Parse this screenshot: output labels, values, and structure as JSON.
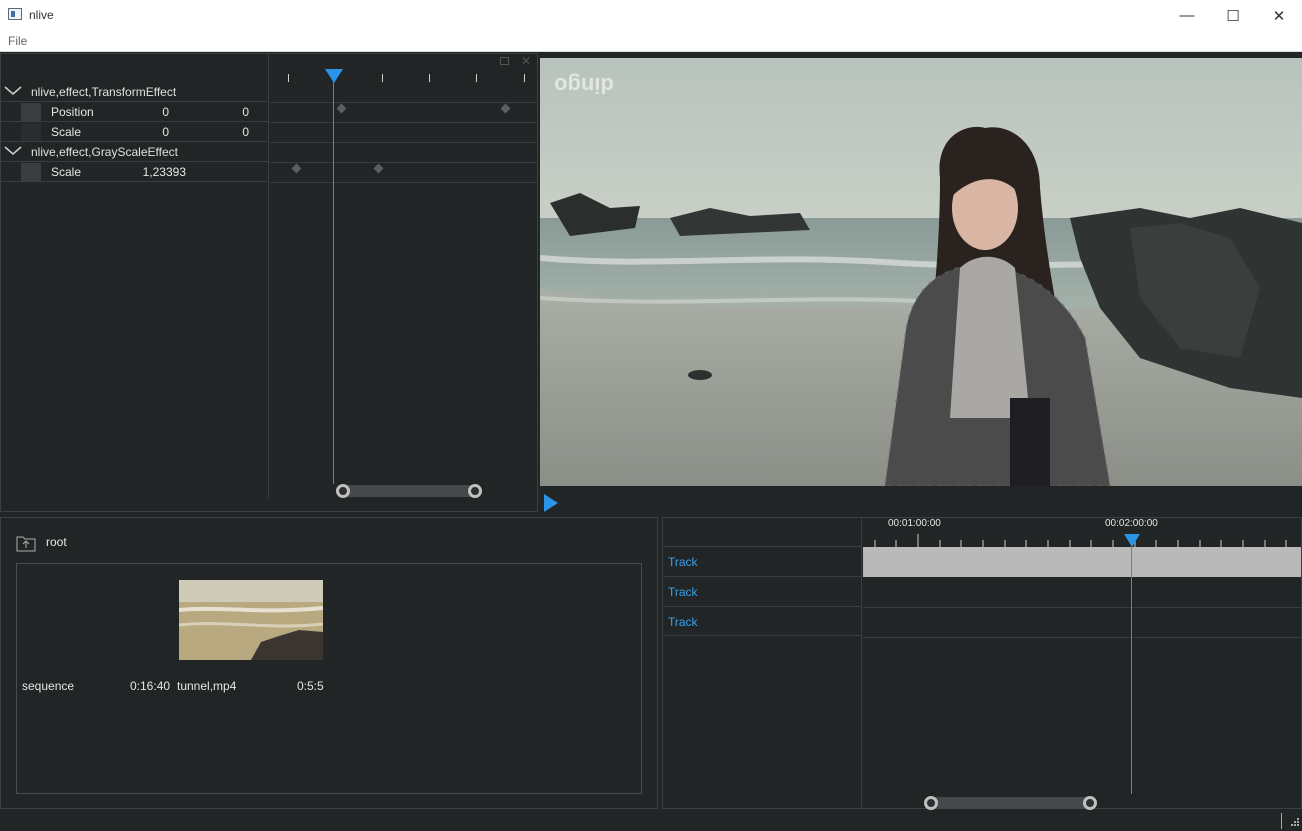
{
  "window": {
    "title": "nlive",
    "minimize": "—",
    "maximize": "☐",
    "close": "✕"
  },
  "menu": {
    "file": "File"
  },
  "effects": {
    "groups": [
      {
        "label": "nlive,effect,TransformEffect",
        "props": [
          {
            "label": "Position",
            "v1": "0",
            "v2": "0"
          },
          {
            "label": "Scale",
            "v1": "0",
            "v2": "0"
          }
        ]
      },
      {
        "label": "nlive,effect,GrayScaleEffect",
        "props": [
          {
            "label": "Scale",
            "v1": "1,23393",
            "v2": ""
          }
        ]
      }
    ]
  },
  "viewer": {
    "watermark": "dingo"
  },
  "media": {
    "folder": "root",
    "items": [
      {
        "name": "sequence",
        "duration": "0:16:40"
      },
      {
        "name": "tunnel,mp4",
        "duration": "0:5:5"
      }
    ]
  },
  "timeline": {
    "ruler_labels": [
      "00:01:00:00",
      "00:02:00:00"
    ],
    "tracks": [
      "Track",
      "Track",
      "Track"
    ]
  },
  "colors": {
    "accent": "#2a95e8",
    "panel_bg": "#222526",
    "clip": "#b9b9b9"
  }
}
